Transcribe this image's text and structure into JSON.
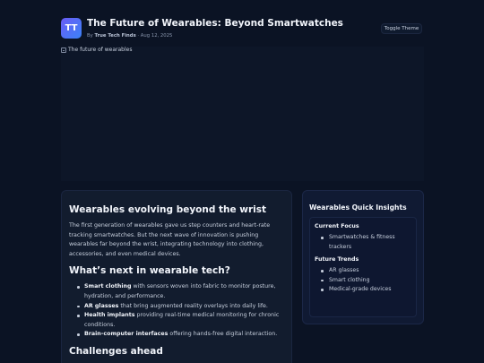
{
  "header": {
    "logo_text": "TT",
    "title": "The Future of Wearables: Beyond Smartwatches",
    "by_prefix": "By",
    "author": "True Tech Finds",
    "date": "Aug 12, 2025",
    "date_separator": "·",
    "theme_button": "Toggle Theme"
  },
  "hero": {
    "alt_text": "The future of wearables"
  },
  "article": {
    "heading1": "Wearables evolving beyond the wrist",
    "intro": "The first generation of wearables gave us step counters and heart-rate tracking smartwatches. But the next wave of innovation is pushing wearables far beyond the wrist, integrating technology into clothing, accessories, and even medical devices.",
    "heading2": "What’s next in wearable tech?",
    "items": [
      {
        "strong": "Smart clothing",
        "text": " with sensors woven into fabric to monitor posture, hydration, and performance."
      },
      {
        "strong": "AR glasses",
        "text": " that bring augmented reality overlays into daily life."
      },
      {
        "strong": "Health implants",
        "text": " providing real-time medical monitoring for chronic conditions."
      },
      {
        "strong": "Brain-computer interfaces",
        "text": " offering hands-free digital interaction."
      }
    ],
    "heading3": "Challenges ahead"
  },
  "sidebar": {
    "title": "Wearables Quick Insights",
    "current_focus_heading": "Current Focus",
    "current_focus_items": [
      "Smartwatches & fitness trackers"
    ],
    "future_trends_heading": "Future Trends",
    "future_trends_items": [
      "AR glasses",
      "Smart clothing",
      "Medical-grade devices"
    ]
  },
  "colors": {
    "background": "#0b1324",
    "card": "#121c2e",
    "sidebar_card": "#101a33",
    "logo_gradient_start": "#6a5cf6",
    "logo_gradient_end": "#3b82f6"
  }
}
